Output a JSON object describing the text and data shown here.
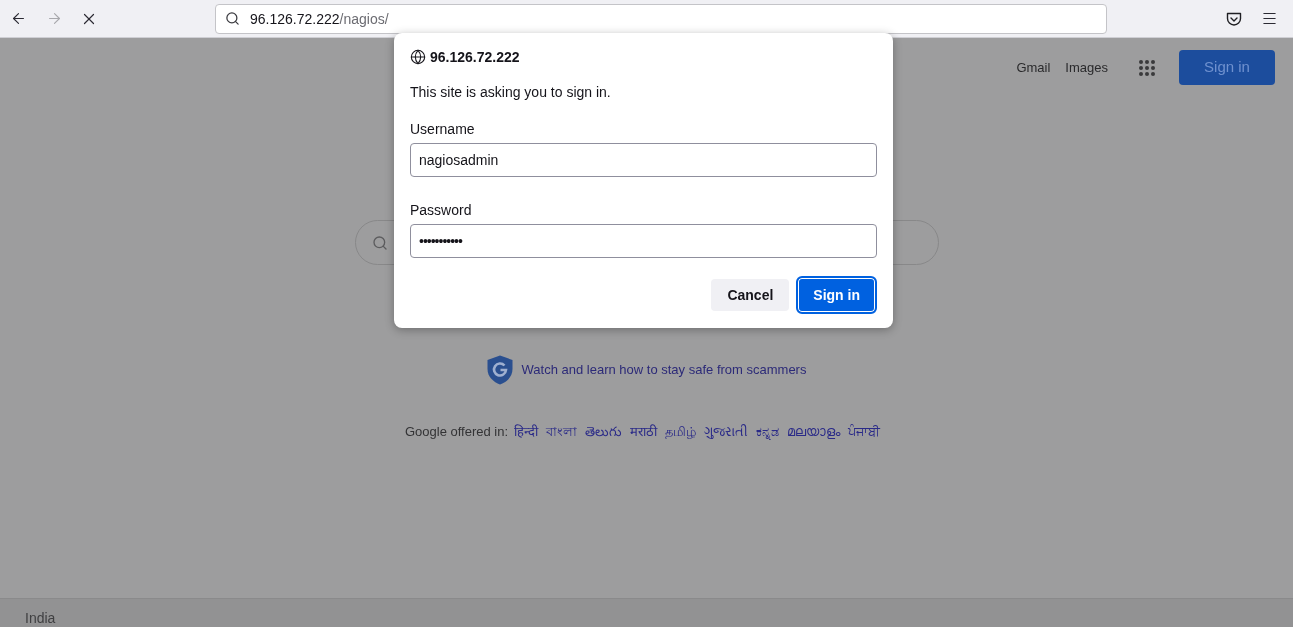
{
  "toolbar": {
    "back": {
      "disabled": false
    },
    "forward": {
      "disabled": true
    },
    "loading": true,
    "url": {
      "host": "96.126.72.222",
      "path": "/nagios/"
    }
  },
  "page": {
    "header_links": [
      "Gmail",
      "Images"
    ],
    "sign_in_button": "Sign in",
    "safety_link": "Watch and learn how to stay safe from scammers",
    "languages": {
      "label": "Google offered in:",
      "links": [
        "हिन्दी",
        "বাংলা",
        "తెలుగు",
        "मराठी",
        "தமிழ்",
        "ગુજરાતી",
        "ಕನ್ನಡ",
        "മലയാളം",
        "ਪੰਜਾਬੀ"
      ]
    },
    "footer": {
      "country": "India"
    }
  },
  "dialog": {
    "host": "96.126.72.222",
    "message": "This site is asking you to sign in.",
    "fields": [
      {
        "label": "Username",
        "value": "nagiosadmin",
        "kind": "text"
      },
      {
        "label": "Password",
        "value": "•••••••••••",
        "kind": "password"
      }
    ],
    "buttons": [
      {
        "label": "Cancel",
        "kind": "secondary",
        "focused": false
      },
      {
        "label": "Sign in",
        "kind": "primary",
        "focused": true
      }
    ]
  }
}
